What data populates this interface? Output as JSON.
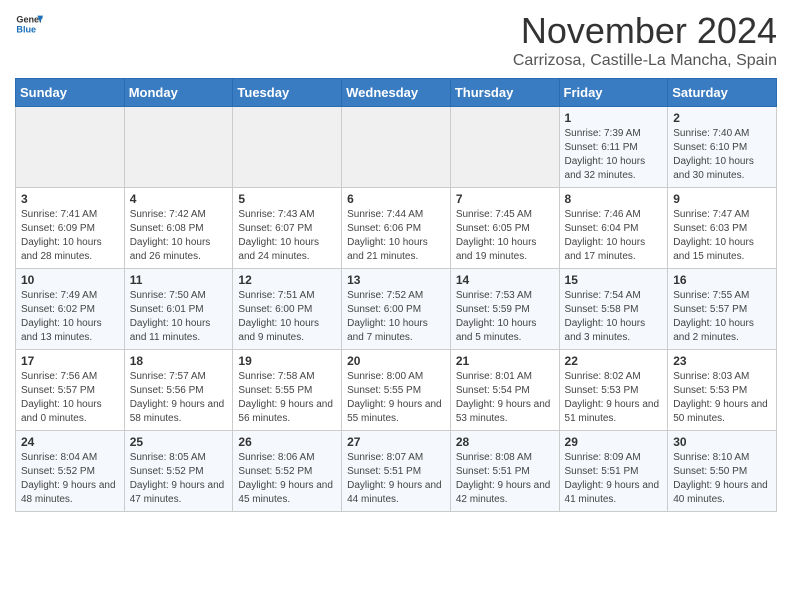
{
  "header": {
    "logo_general": "General",
    "logo_blue": "Blue",
    "month_title": "November 2024",
    "location": "Carrizosa, Castille-La Mancha, Spain"
  },
  "weekdays": [
    "Sunday",
    "Monday",
    "Tuesday",
    "Wednesday",
    "Thursday",
    "Friday",
    "Saturday"
  ],
  "weeks": [
    [
      {
        "day": "",
        "info": ""
      },
      {
        "day": "",
        "info": ""
      },
      {
        "day": "",
        "info": ""
      },
      {
        "day": "",
        "info": ""
      },
      {
        "day": "",
        "info": ""
      },
      {
        "day": "1",
        "info": "Sunrise: 7:39 AM\nSunset: 6:11 PM\nDaylight: 10 hours and 32 minutes."
      },
      {
        "day": "2",
        "info": "Sunrise: 7:40 AM\nSunset: 6:10 PM\nDaylight: 10 hours and 30 minutes."
      }
    ],
    [
      {
        "day": "3",
        "info": "Sunrise: 7:41 AM\nSunset: 6:09 PM\nDaylight: 10 hours and 28 minutes."
      },
      {
        "day": "4",
        "info": "Sunrise: 7:42 AM\nSunset: 6:08 PM\nDaylight: 10 hours and 26 minutes."
      },
      {
        "day": "5",
        "info": "Sunrise: 7:43 AM\nSunset: 6:07 PM\nDaylight: 10 hours and 24 minutes."
      },
      {
        "day": "6",
        "info": "Sunrise: 7:44 AM\nSunset: 6:06 PM\nDaylight: 10 hours and 21 minutes."
      },
      {
        "day": "7",
        "info": "Sunrise: 7:45 AM\nSunset: 6:05 PM\nDaylight: 10 hours and 19 minutes."
      },
      {
        "day": "8",
        "info": "Sunrise: 7:46 AM\nSunset: 6:04 PM\nDaylight: 10 hours and 17 minutes."
      },
      {
        "day": "9",
        "info": "Sunrise: 7:47 AM\nSunset: 6:03 PM\nDaylight: 10 hours and 15 minutes."
      }
    ],
    [
      {
        "day": "10",
        "info": "Sunrise: 7:49 AM\nSunset: 6:02 PM\nDaylight: 10 hours and 13 minutes."
      },
      {
        "day": "11",
        "info": "Sunrise: 7:50 AM\nSunset: 6:01 PM\nDaylight: 10 hours and 11 minutes."
      },
      {
        "day": "12",
        "info": "Sunrise: 7:51 AM\nSunset: 6:00 PM\nDaylight: 10 hours and 9 minutes."
      },
      {
        "day": "13",
        "info": "Sunrise: 7:52 AM\nSunset: 6:00 PM\nDaylight: 10 hours and 7 minutes."
      },
      {
        "day": "14",
        "info": "Sunrise: 7:53 AM\nSunset: 5:59 PM\nDaylight: 10 hours and 5 minutes."
      },
      {
        "day": "15",
        "info": "Sunrise: 7:54 AM\nSunset: 5:58 PM\nDaylight: 10 hours and 3 minutes."
      },
      {
        "day": "16",
        "info": "Sunrise: 7:55 AM\nSunset: 5:57 PM\nDaylight: 10 hours and 2 minutes."
      }
    ],
    [
      {
        "day": "17",
        "info": "Sunrise: 7:56 AM\nSunset: 5:57 PM\nDaylight: 10 hours and 0 minutes."
      },
      {
        "day": "18",
        "info": "Sunrise: 7:57 AM\nSunset: 5:56 PM\nDaylight: 9 hours and 58 minutes."
      },
      {
        "day": "19",
        "info": "Sunrise: 7:58 AM\nSunset: 5:55 PM\nDaylight: 9 hours and 56 minutes."
      },
      {
        "day": "20",
        "info": "Sunrise: 8:00 AM\nSunset: 5:55 PM\nDaylight: 9 hours and 55 minutes."
      },
      {
        "day": "21",
        "info": "Sunrise: 8:01 AM\nSunset: 5:54 PM\nDaylight: 9 hours and 53 minutes."
      },
      {
        "day": "22",
        "info": "Sunrise: 8:02 AM\nSunset: 5:53 PM\nDaylight: 9 hours and 51 minutes."
      },
      {
        "day": "23",
        "info": "Sunrise: 8:03 AM\nSunset: 5:53 PM\nDaylight: 9 hours and 50 minutes."
      }
    ],
    [
      {
        "day": "24",
        "info": "Sunrise: 8:04 AM\nSunset: 5:52 PM\nDaylight: 9 hours and 48 minutes."
      },
      {
        "day": "25",
        "info": "Sunrise: 8:05 AM\nSunset: 5:52 PM\nDaylight: 9 hours and 47 minutes."
      },
      {
        "day": "26",
        "info": "Sunrise: 8:06 AM\nSunset: 5:52 PM\nDaylight: 9 hours and 45 minutes."
      },
      {
        "day": "27",
        "info": "Sunrise: 8:07 AM\nSunset: 5:51 PM\nDaylight: 9 hours and 44 minutes."
      },
      {
        "day": "28",
        "info": "Sunrise: 8:08 AM\nSunset: 5:51 PM\nDaylight: 9 hours and 42 minutes."
      },
      {
        "day": "29",
        "info": "Sunrise: 8:09 AM\nSunset: 5:51 PM\nDaylight: 9 hours and 41 minutes."
      },
      {
        "day": "30",
        "info": "Sunrise: 8:10 AM\nSunset: 5:50 PM\nDaylight: 9 hours and 40 minutes."
      }
    ]
  ]
}
